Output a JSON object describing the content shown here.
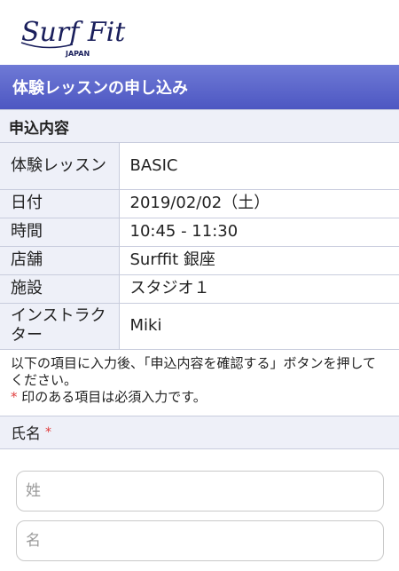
{
  "brand": {
    "logo_text": "Surf Fit",
    "logo_sub": "JAPAN"
  },
  "page_title": "体験レッスンの申し込み",
  "details": {
    "heading": "申込内容",
    "rows": [
      {
        "label": "体験レッスン",
        "value": "BASIC"
      },
      {
        "label": "日付",
        "value": "2019/02/02（土）"
      },
      {
        "label": "時間",
        "value": "10:45 - 11:30"
      },
      {
        "label": "店舗",
        "value": "Surffit 銀座"
      },
      {
        "label": "施設",
        "value": "スタジオ１"
      },
      {
        "label": "インストラクター",
        "value": "Miki"
      }
    ]
  },
  "instructions": {
    "line1": "以下の項目に入力後、「申込内容を確認する」ボタンを押してください。",
    "required_mark": "*",
    "line2": "印のある項目は必須入力です。"
  },
  "form": {
    "name_label": "氏名",
    "required_mark": "*",
    "last_name_placeholder": "姓",
    "first_name_placeholder": "名",
    "last_name_value": "",
    "first_name_value": ""
  },
  "colors": {
    "header": "#5a64c9",
    "section_bg": "#eef0f8",
    "required": "#e03c3c"
  }
}
